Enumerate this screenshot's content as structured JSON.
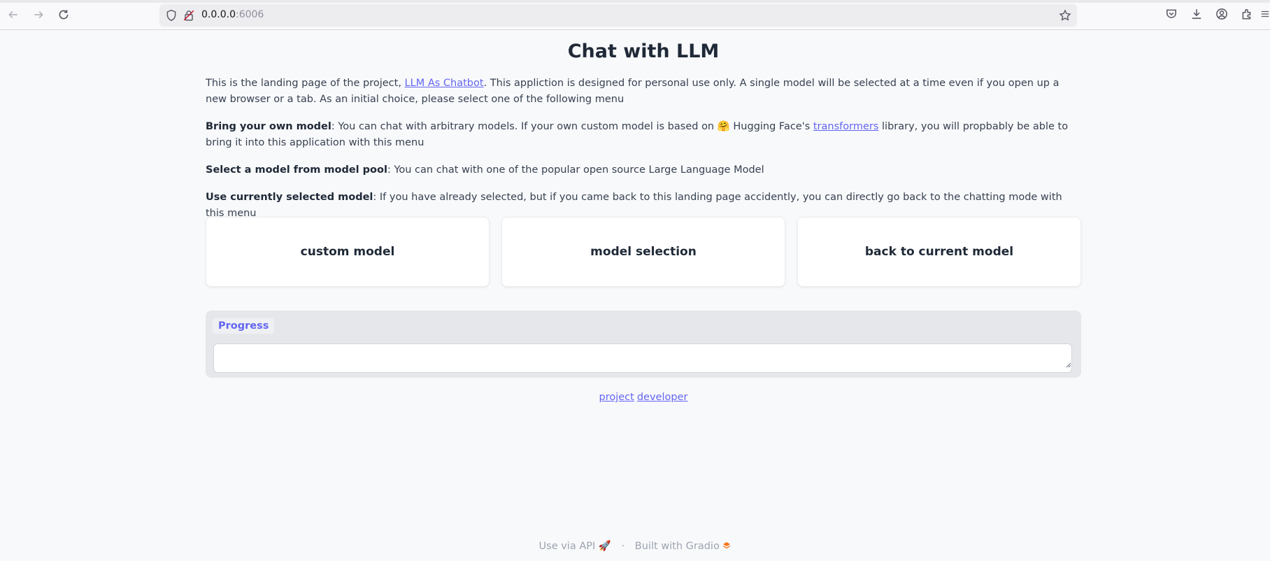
{
  "browser": {
    "url_host": "0.0.0.0",
    "url_port": ":6006"
  },
  "page": {
    "title": "Chat with LLM",
    "intro": {
      "before_link": "This is the landing page of the project, ",
      "link_text": "LLM As Chatbot",
      "after_link": ". This appliction is designed for personal use only. A single model will be selected at a time even if you open up a new browser or a tab. As an initial choice, please select one of the following menu"
    },
    "byom": {
      "label": "Bring your own model",
      "before_link": ": You can chat with arbitrary models. If your own custom model is based on 🤗 Hugging Face's ",
      "link_text": "transformers",
      "after_link": " library, you will propbably be able to bring it into this application with this menu"
    },
    "pool": {
      "label": "Select a model from model pool",
      "text": ": You can chat with one of the popular open source Large Language Model"
    },
    "current": {
      "label": "Use currently selected model",
      "text": ": If you have already selected, but if you came back to this landing page accidently, you can directly go back to the chatting mode with this menu"
    },
    "buttons": [
      "custom model",
      "model selection",
      "back to current model"
    ],
    "progress_label": "Progress",
    "progress_value": "",
    "links": [
      "project",
      "developer"
    ]
  },
  "footer": {
    "api_text": "Use via API",
    "separator": "·",
    "built_text": "Built with Gradio"
  },
  "colors": {
    "accent": "#6366f1",
    "background": "#f8f9fb"
  }
}
